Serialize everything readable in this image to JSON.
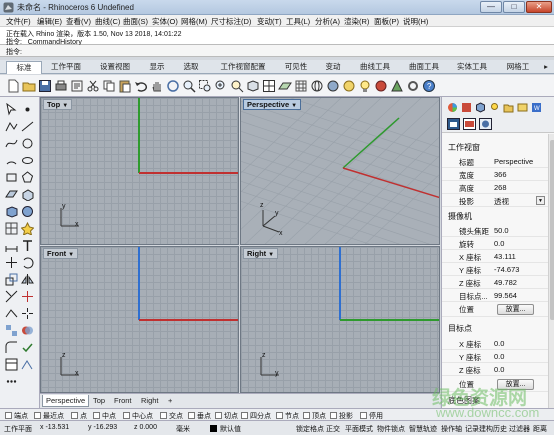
{
  "window": {
    "title": "未命名 - Rhinoceros 6 Undefined",
    "minimize": "—",
    "maximize": "□",
    "close": "✕"
  },
  "menu": [
    "文件(F)",
    "编辑(E)",
    "查看(V)",
    "曲线(C)",
    "曲面(S)",
    "实体(O)",
    "网格(M)",
    "尺寸标注(D)",
    "变动(T)",
    "工具(L)",
    "分析(A)",
    "渲染(R)",
    "面板(P)",
    "说明(H)"
  ],
  "history": {
    "line1": "正在载入 Rhino 渲染，版本 1.50, Nov 13 2018, 14:01:22",
    "line2": "指令: _CommandHistory"
  },
  "command": {
    "prompt": "指令:"
  },
  "tabs": [
    "标准",
    "工作平面",
    "设置视图",
    "显示",
    "选取",
    "工作视窗配置",
    "可见性",
    "变动",
    "曲线工具",
    "曲面工具",
    "实体工具",
    "网格工"
  ],
  "tabs_overflow": "▸",
  "viewports": {
    "top": "Top",
    "perspective": "Perspective",
    "front": "Front",
    "right": "Right",
    "caret": "▼"
  },
  "axes": {
    "top": {
      "y": "y",
      "x": "x"
    },
    "perspective": {
      "z": "z",
      "y": "y",
      "x": "x"
    },
    "front": {
      "z": "z",
      "x": "x"
    },
    "right": {
      "z": "z",
      "y": "y"
    }
  },
  "view_tabs": [
    "Perspective",
    "Top",
    "Front",
    "Right",
    "+"
  ],
  "panel": {
    "section_viewport": "工作视窗",
    "rows1": [
      {
        "k": "标题",
        "v": "Perspective"
      },
      {
        "k": "宽度",
        "v": "366"
      },
      {
        "k": "高度",
        "v": "268"
      },
      {
        "k": "投影",
        "v": "透视"
      }
    ],
    "section_camera": "摄像机",
    "rows2": [
      {
        "k": "镜头焦距",
        "v": "50.0"
      },
      {
        "k": "旋转",
        "v": "0.0"
      },
      {
        "k": "X 座标",
        "v": "43.111"
      },
      {
        "k": "Y 座标",
        "v": "-74.673"
      },
      {
        "k": "Z 座标",
        "v": "49.782"
      },
      {
        "k": "目标点...",
        "v": "99.564"
      },
      {
        "k": "位置",
        "v": ""
      }
    ],
    "place_button": "放置...",
    "section_target": "目标点",
    "rows3": [
      {
        "k": "X 座标",
        "v": "0.0"
      },
      {
        "k": "Y 座标",
        "v": "0.0"
      },
      {
        "k": "Z 座标",
        "v": "0.0"
      },
      {
        "k": "位置",
        "v": ""
      }
    ],
    "place_button2": "放置...",
    "section_wallpaper": "底色图案"
  },
  "osnap": [
    "端点",
    "最近点",
    "点",
    "中点",
    "中心点",
    "交点",
    "垂点",
    "切点",
    "四分点",
    "节点",
    "顶点",
    "投影",
    "停用"
  ],
  "status": {
    "plane": "工作平面",
    "x": "x -13.531",
    "y": "y -16.293",
    "z": "z 0.000",
    "unit": "毫米",
    "layer": "默认值",
    "items": [
      "锁定格点",
      "正交",
      "平面模式",
      "物件锁点",
      "智慧轨迹",
      "操作轴",
      "记录建构历史",
      "过滤器",
      "距离"
    ]
  },
  "watermark": {
    "main": "绿色资源网",
    "url": "www.downcc.com"
  },
  "colors": {
    "x_axis": "#c03030",
    "y_axis": "#2e9a2e",
    "viewport_bg": "#a7aeb6",
    "perspective_bg": "#a9b0b8"
  }
}
